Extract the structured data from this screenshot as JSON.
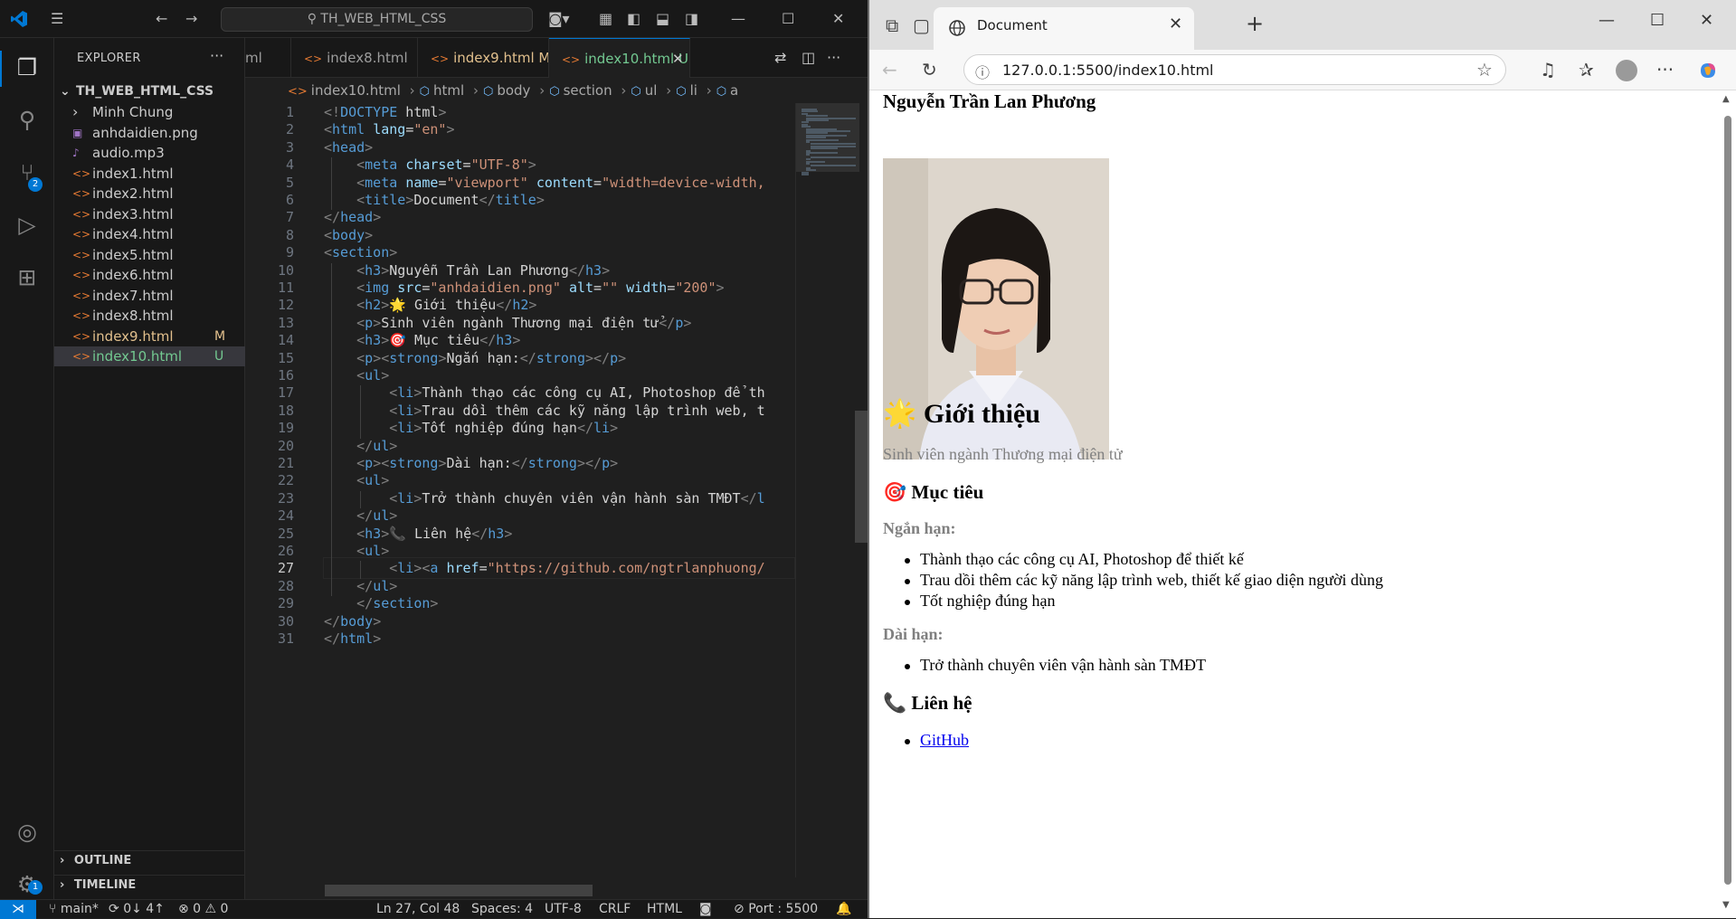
{
  "vscode": {
    "search_text": "TH_WEB_HTML_CSS",
    "explorer_title": "EXPLORER",
    "folder_name": "TH_WEB_HTML_CSS",
    "tree": [
      {
        "name": "Minh Chung",
        "type": "folder",
        "mark": ""
      },
      {
        "name": "anhdaidien.png",
        "type": "image",
        "mark": ""
      },
      {
        "name": "audio.mp3",
        "type": "audio",
        "mark": ""
      },
      {
        "name": "index1.html",
        "type": "html",
        "mark": ""
      },
      {
        "name": "index2.html",
        "type": "html",
        "mark": ""
      },
      {
        "name": "index3.html",
        "type": "html",
        "mark": ""
      },
      {
        "name": "index4.html",
        "type": "html",
        "mark": ""
      },
      {
        "name": "index5.html",
        "type": "html",
        "mark": ""
      },
      {
        "name": "index6.html",
        "type": "html",
        "mark": ""
      },
      {
        "name": "index7.html",
        "type": "html",
        "mark": ""
      },
      {
        "name": "index8.html",
        "type": "html",
        "mark": ""
      },
      {
        "name": "index9.html",
        "type": "html",
        "mark": "M"
      },
      {
        "name": "index10.html",
        "type": "html",
        "mark": "U"
      }
    ],
    "outline_label": "OUTLINE",
    "timeline_label": "TIMELINE",
    "badges": {
      "scm": "2",
      "accounts": "1"
    },
    "tabs": [
      {
        "label": "ml",
        "mark": ""
      },
      {
        "label": "index8.html",
        "mark": ""
      },
      {
        "label": "index9.html",
        "mark": "M"
      },
      {
        "label": "index10.html",
        "mark": "U"
      }
    ],
    "breadcrumbs": [
      "index10.html",
      "html",
      "body",
      "section",
      "ul",
      "li",
      "a"
    ],
    "code_lines": [
      "<!DOCTYPE html>",
      "<html lang=\"en\">",
      "<head>",
      "    <meta charset=\"UTF-8\">",
      "    <meta name=\"viewport\" content=\"width=device-width,",
      "    <title>Document</title>",
      "</head>",
      "<body>",
      "<section>",
      "    <h3>Nguyễn Trần Lan Phương</h3>",
      "    <img src=\"anhdaidien.png\" alt=\"\" width=\"200\">",
      "    <h2>🌟 Giới thiệu</h2>",
      "    <p>Sinh viên ngành Thương mại điện tử</p>",
      "    <h3>🎯 Mục tiêu</h3>",
      "    <p><strong>Ngắn hạn:</strong></p>",
      "    <ul>",
      "        <li>Thành thạo các công cụ AI, Photoshop để th",
      "        <li>Trau dồi thêm các kỹ năng lập trình web, t",
      "        <li>Tốt nghiệp đúng hạn</li>",
      "    </ul>",
      "    <p><strong>Dài hạn:</strong></p>",
      "    <ul>",
      "        <li>Trở thành chuyên viên vận hành sàn TMĐT</l",
      "    </ul>",
      "    <h3>📞 Liên hệ</h3>",
      "    <ul>",
      "        <li><a href=\"https://github.com/ngtrlanphuong/",
      "    </ul>",
      "    </section>",
      "</body>",
      "</html>"
    ],
    "current_line": 27,
    "status": {
      "branch": "main*",
      "sync": "0↓ 4↑",
      "problems": "⊗ 0 ⚠ 0",
      "position": "Ln 27, Col 48",
      "spaces": "Spaces: 4",
      "encoding": "UTF-8",
      "eol": "CRLF",
      "language": "HTML",
      "port": "Port : 5500"
    }
  },
  "browser": {
    "tab_title": "Document",
    "url": "127.0.0.1:5500/index10.html",
    "page": {
      "name": "Nguyễn Trần Lan Phương",
      "intro_emoji": "🌟",
      "intro_heading": "Giới thiệu",
      "intro_text": "Sinh viên ngành Thương mại điện tử",
      "goal_emoji": "🎯",
      "goal_heading": "Mục tiêu",
      "short_term_label": "Ngắn hạn:",
      "short_term_items": [
        "Thành thạo các công cụ AI, Photoshop để thiết kế",
        "Trau dồi thêm các kỹ năng lập trình web, thiết kế giao diện người dùng",
        "Tốt nghiệp đúng hạn"
      ],
      "long_term_label": "Dài hạn:",
      "long_term_items": [
        "Trở thành chuyên viên vận hành sàn TMĐT"
      ],
      "contact_emoji": "📞",
      "contact_heading": "Liên hệ",
      "contact_link": "GitHub"
    }
  }
}
